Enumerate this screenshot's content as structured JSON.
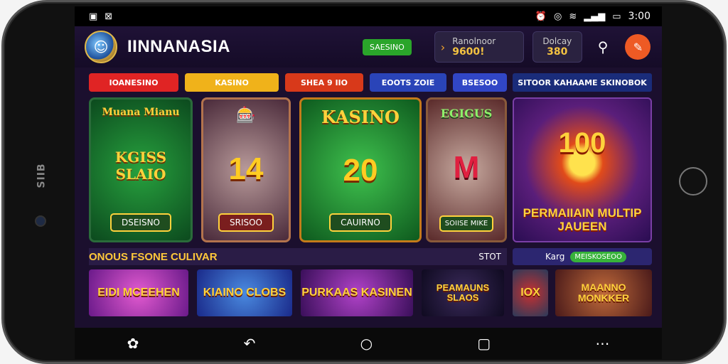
{
  "statusbar": {
    "left_icons": [
      "notification-icon",
      "image-icon"
    ],
    "time": "3:00",
    "right_icons": [
      "alarm-icon",
      "vibrate-icon",
      "wifi-icon",
      "signal-icon",
      "battery-icon"
    ]
  },
  "header": {
    "brand": "IINNANASIA",
    "green_button": "SAESINO",
    "balance_label": "Ranolnoor",
    "balance_value": "9600!",
    "bonus_label": "Dolcay",
    "bonus_value": "380"
  },
  "categories": [
    {
      "label": "IOANESINO",
      "color": "#e02424"
    },
    {
      "label": "KASINO",
      "color": "#f0b21a"
    },
    {
      "label": "SHEA 9 IIO",
      "color": "#d8391a"
    },
    {
      "label": "EOOTS ZOIE",
      "color": "#2a44b8"
    },
    {
      "label": "BSESOO",
      "color": "#3146c6"
    }
  ],
  "promo_title": "SITOOR KAHAAME SKINOBOK",
  "cards": [
    {
      "title": "Muana Mianu",
      "big": "KGISS SLAIO",
      "button": "DSEISNO"
    },
    {
      "title": "",
      "big": "14",
      "button": "SRISOO"
    },
    {
      "title": "KASINO",
      "big": "20",
      "button": "CAUIRNO"
    },
    {
      "title": "EGIGUS",
      "big": "M",
      "button": "SOIISE MIKE"
    }
  ],
  "promo": {
    "number": "100",
    "tagline": "PERMAIIAIN MULTIP JAUEEN"
  },
  "section": {
    "title": "ONOUS FSONE CULIVAR",
    "more": "STOT"
  },
  "filter": {
    "label": "Karg",
    "pill": "MEISKOSEOO"
  },
  "tiles": [
    "EIDI MCEEHEN",
    "KIAINO CLOBS",
    "PURKAAS KASINEN",
    "PEAMAUNS SLAOS",
    "IOX",
    "MAANNO MONKKER"
  ],
  "navbar": {
    "icons": [
      "assistant-icon",
      "back-icon",
      "home-icon",
      "recents-icon",
      "more-icon"
    ]
  },
  "device": {
    "side_label": "SIIB"
  }
}
